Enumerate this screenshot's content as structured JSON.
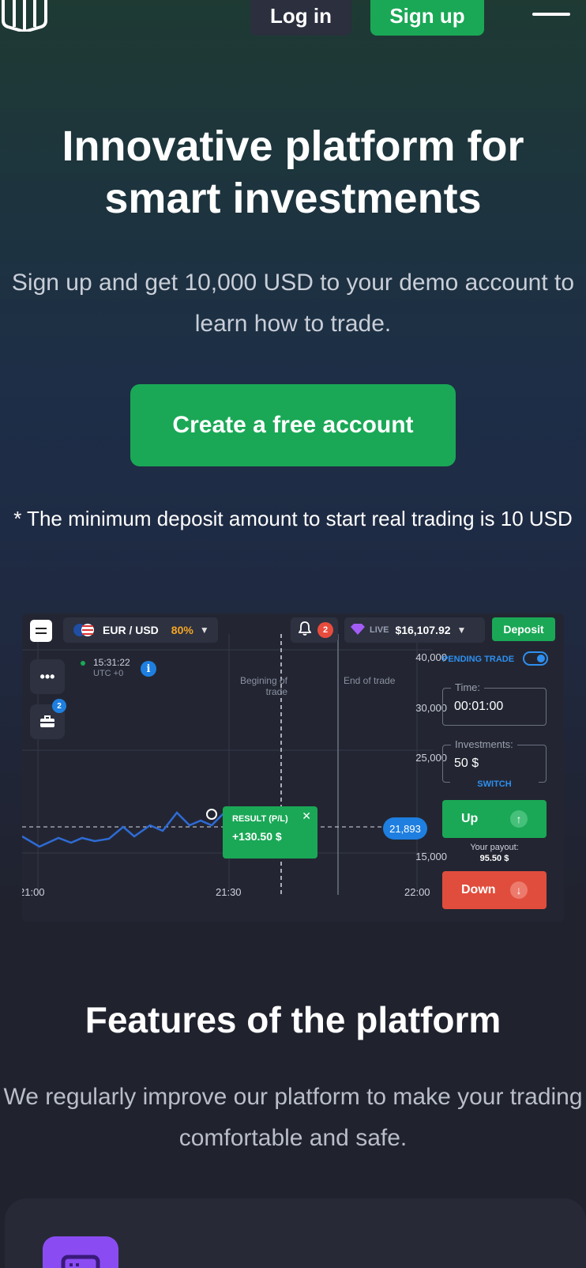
{
  "header": {
    "login_label": "Log in",
    "signup_label": "Sign up"
  },
  "hero": {
    "title": "Innovative platform for smart investments",
    "subtitle": "Sign up and get 10,000 USD to your demo account to learn how to trade.",
    "cta_label": "Create a free account",
    "min_deposit_note": "* The minimum deposit amount to start real trading is 10 USD"
  },
  "mockup": {
    "pair": "EUR / USD",
    "pair_pct": "80%",
    "notifications": "2",
    "account_type": "LIVE",
    "balance": "$16,107.92",
    "deposit_label": "Deposit",
    "trades_badge": "2",
    "clock_time": "15:31:22",
    "clock_tz": "UTC +0",
    "begin_label": "Begining of trade",
    "end_label": "End of trade",
    "y_ticks": [
      "40,000",
      "30,000",
      "25,000",
      "15,000"
    ],
    "x_ticks": [
      "21:00",
      "21:30",
      "22:00"
    ],
    "current_price": "21,893",
    "result_title": "RESULT (P/L)",
    "result_value": "+130.50 $",
    "pending_label": "PENDING TRADE",
    "time_label": "Time:",
    "time_value": "00:01:00",
    "invest_label": "Investments:",
    "invest_value": "50 $",
    "switch_label": "SWITCH",
    "up_label": "Up",
    "payout_label": "Your payout:",
    "payout_value": "95.50 $",
    "down_label": "Down",
    "colors": {
      "up": "#1aa856",
      "down": "#e14d3c",
      "accent": "#1e7fe0"
    }
  },
  "features": {
    "title": "Features of the platform",
    "subtitle": "We regularly improve our platform to make your trading comfortable and safe."
  }
}
